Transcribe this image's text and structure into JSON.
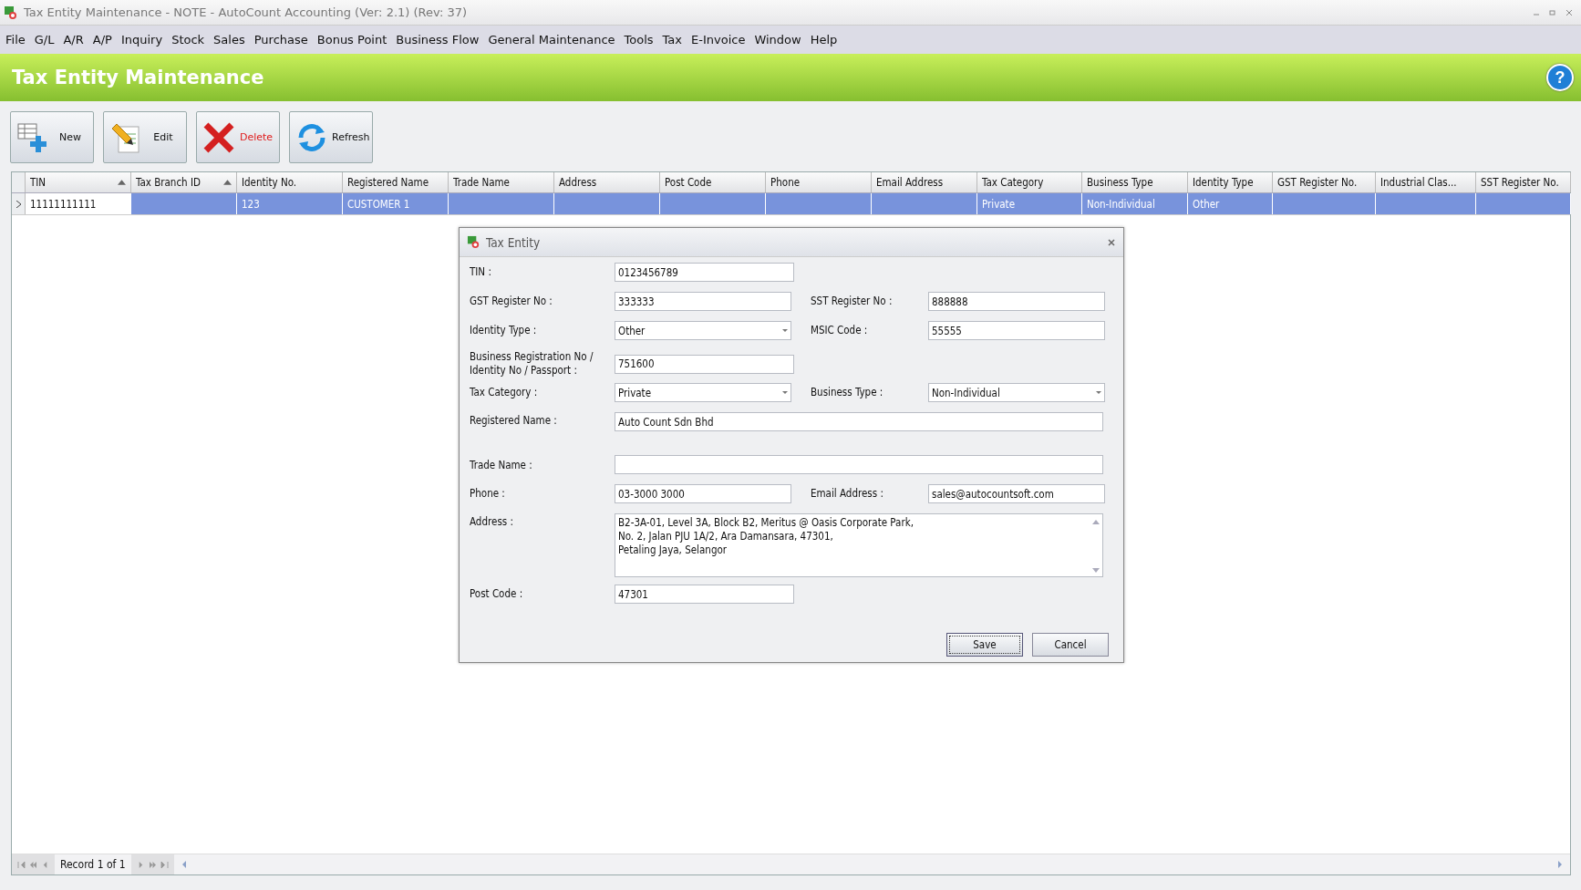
{
  "window": {
    "title": "Tax Entity Maintenance - NOTE - AutoCount Accounting (Ver: 2.1) (Rev: 37)"
  },
  "menu": [
    "File",
    "G/L",
    "A/R",
    "A/P",
    "Inquiry",
    "Stock",
    "Sales",
    "Purchase",
    "Bonus Point",
    "Business Flow",
    "General Maintenance",
    "Tools",
    "Tax",
    "E-Invoice",
    "Window",
    "Help"
  ],
  "header": {
    "title": "Tax Entity Maintenance",
    "help": "?"
  },
  "toolbar": [
    {
      "label": "New",
      "kind": "new"
    },
    {
      "label": "Edit",
      "kind": "edit"
    },
    {
      "label": "Delete",
      "kind": "delete"
    },
    {
      "label": "Refresh",
      "kind": "refresh"
    }
  ],
  "table": {
    "columns": [
      {
        "label": "TIN",
        "sorted": true
      },
      {
        "label": "Tax Branch ID",
        "sorted": true
      },
      {
        "label": "Identity No.",
        "sorted": false
      },
      {
        "label": "Registered Name",
        "sorted": false
      },
      {
        "label": "Trade Name",
        "sorted": false
      },
      {
        "label": "Address",
        "sorted": false
      },
      {
        "label": "Post Code",
        "sorted": false
      },
      {
        "label": "Phone",
        "sorted": false
      },
      {
        "label": "Email Address",
        "sorted": false
      },
      {
        "label": "Tax Category",
        "sorted": false
      },
      {
        "label": "Business Type",
        "sorted": false
      },
      {
        "label": "Identity Type",
        "sorted": false
      },
      {
        "label": "GST Register No.",
        "sorted": false
      },
      {
        "label": "Industrial Clas...",
        "sorted": false
      },
      {
        "label": "SST Register No.",
        "sorted": false
      }
    ],
    "rows": [
      {
        "selected": true,
        "cells": [
          {
            "text": "11111111111",
            "focused": true
          },
          {
            "focused": false
          },
          {
            "text": "123",
            "focused": false
          },
          {
            "text": "CUSTOMER 1",
            "focused": false
          },
          {
            "focused": false
          },
          {
            "focused": false
          },
          {
            "focused": false
          },
          {
            "focused": false
          },
          {
            "focused": false
          },
          {
            "text": "Private",
            "focused": false
          },
          {
            "text": "Non-Individual",
            "focused": false
          },
          {
            "text": "Other",
            "focused": false
          },
          {
            "focused": false
          },
          {
            "focused": false
          },
          {
            "focused": false
          }
        ]
      }
    ]
  },
  "dialog": {
    "title": "Tax Entity",
    "rows": [
      [
        {
          "label": "TIN :",
          "value": "0123456789",
          "kind": "text"
        }
      ],
      [
        {
          "label": "GST Register No :",
          "value": "333333",
          "kind": "text"
        },
        {
          "label": "SST Register No :",
          "value": "888888",
          "kind": "text"
        }
      ],
      [
        {
          "label": "Identity Type :",
          "value": "Other",
          "kind": "dropdown"
        },
        {
          "label": "MSIC Code :",
          "value": "55555",
          "kind": "text"
        }
      ],
      [
        {
          "label": "Business Registration No / Identity No / Passport :",
          "value": "751600",
          "kind": "text"
        }
      ],
      [
        {
          "label": "Tax Category :",
          "value": "Private",
          "kind": "dropdown"
        },
        {
          "label": "Business Type :",
          "value": "Non-Individual",
          "kind": "dropdown"
        }
      ],
      [
        {
          "label": "Registered Name :",
          "value": "Auto Count Sdn Bhd",
          "kind": "wide"
        }
      ],
      [
        {
          "label": "Trade Name :",
          "kind": "wide"
        }
      ],
      [
        {
          "label": "Phone :",
          "value": "03-3000 3000",
          "kind": "text"
        },
        {
          "label": "Email Address :",
          "value": "sales@autocountsoft.com",
          "kind": "text"
        }
      ],
      [
        {
          "label": "Address :",
          "lines": [
            "B2-3A-01, Level 3A, Block B2, Meritus @ Oasis Corporate Park,",
            "No. 2, Jalan PJU 1A/2, Ara Damansara, 47301,",
            "Petaling Jaya, Selangor"
          ],
          "kind": "memo"
        }
      ],
      [
        {
          "label": "Post Code :",
          "value": "47301",
          "kind": "text"
        }
      ]
    ],
    "buttons": [
      {
        "label": "Save",
        "default": true
      },
      {
        "label": "Cancel",
        "default": false
      }
    ]
  },
  "navigator": {
    "text": "Record 1 of 1"
  }
}
